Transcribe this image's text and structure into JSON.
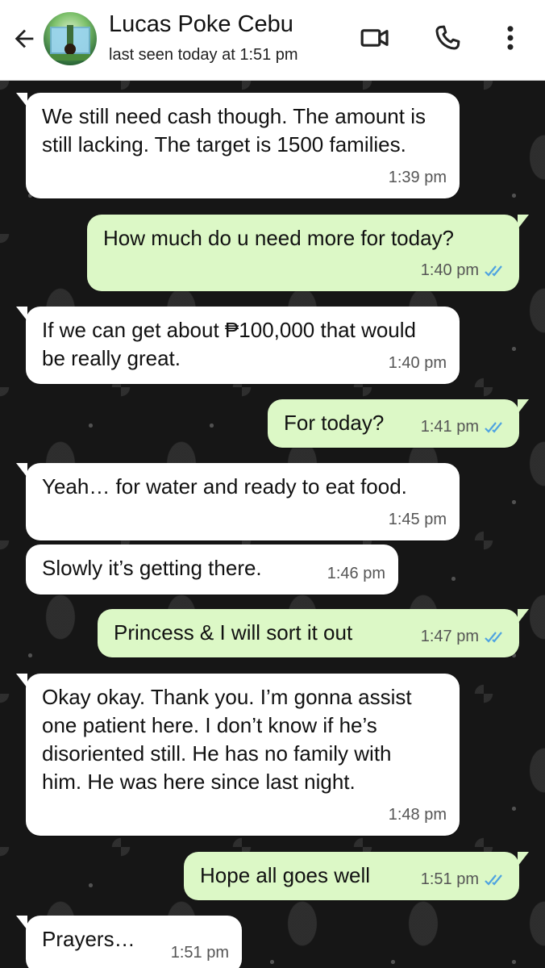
{
  "header": {
    "contact_name": "Lucas Poke Cebu",
    "status": "last seen today at 1:51 pm",
    "icons": [
      "back-arrow-icon",
      "video-call-icon",
      "phone-icon",
      "more-vert-icon"
    ]
  },
  "colors": {
    "incoming_bubble": "#ffffff",
    "outgoing_bubble": "#dcf8c6",
    "read_ticks": "#4fa3e0",
    "chat_wallpaper": "#161616"
  },
  "messages": [
    {
      "direction": "in",
      "text": "We still need cash though. The amount is still lacking. The target is 1500 families.",
      "time": "1:39 pm"
    },
    {
      "direction": "out",
      "text": "How much do u need more for today?",
      "time": "1:40 pm",
      "status": "read"
    },
    {
      "direction": "in",
      "text": "If we can get about ₱100,000 that would be really great.",
      "time": "1:40 pm"
    },
    {
      "direction": "out",
      "text": "For today?",
      "time": "1:41 pm",
      "status": "read"
    },
    {
      "direction": "in",
      "text": "Yeah… for water and ready to eat food.",
      "time": "1:45 pm"
    },
    {
      "direction": "in",
      "text": "Slowly it’s getting there.",
      "time": "1:46 pm"
    },
    {
      "direction": "out",
      "text": "Princess & I will sort it out",
      "time": "1:47 pm",
      "status": "read"
    },
    {
      "direction": "in",
      "text": "Okay okay. Thank you. I’m gonna assist one patient here. I don’t know if he’s disoriented still. He has no family with him. He was here since last night.",
      "time": "1:48 pm"
    },
    {
      "direction": "out",
      "text": "Hope all goes well",
      "time": "1:51 pm",
      "status": "read"
    },
    {
      "direction": "in",
      "text": "Prayers…",
      "time": "1:51 pm"
    }
  ]
}
